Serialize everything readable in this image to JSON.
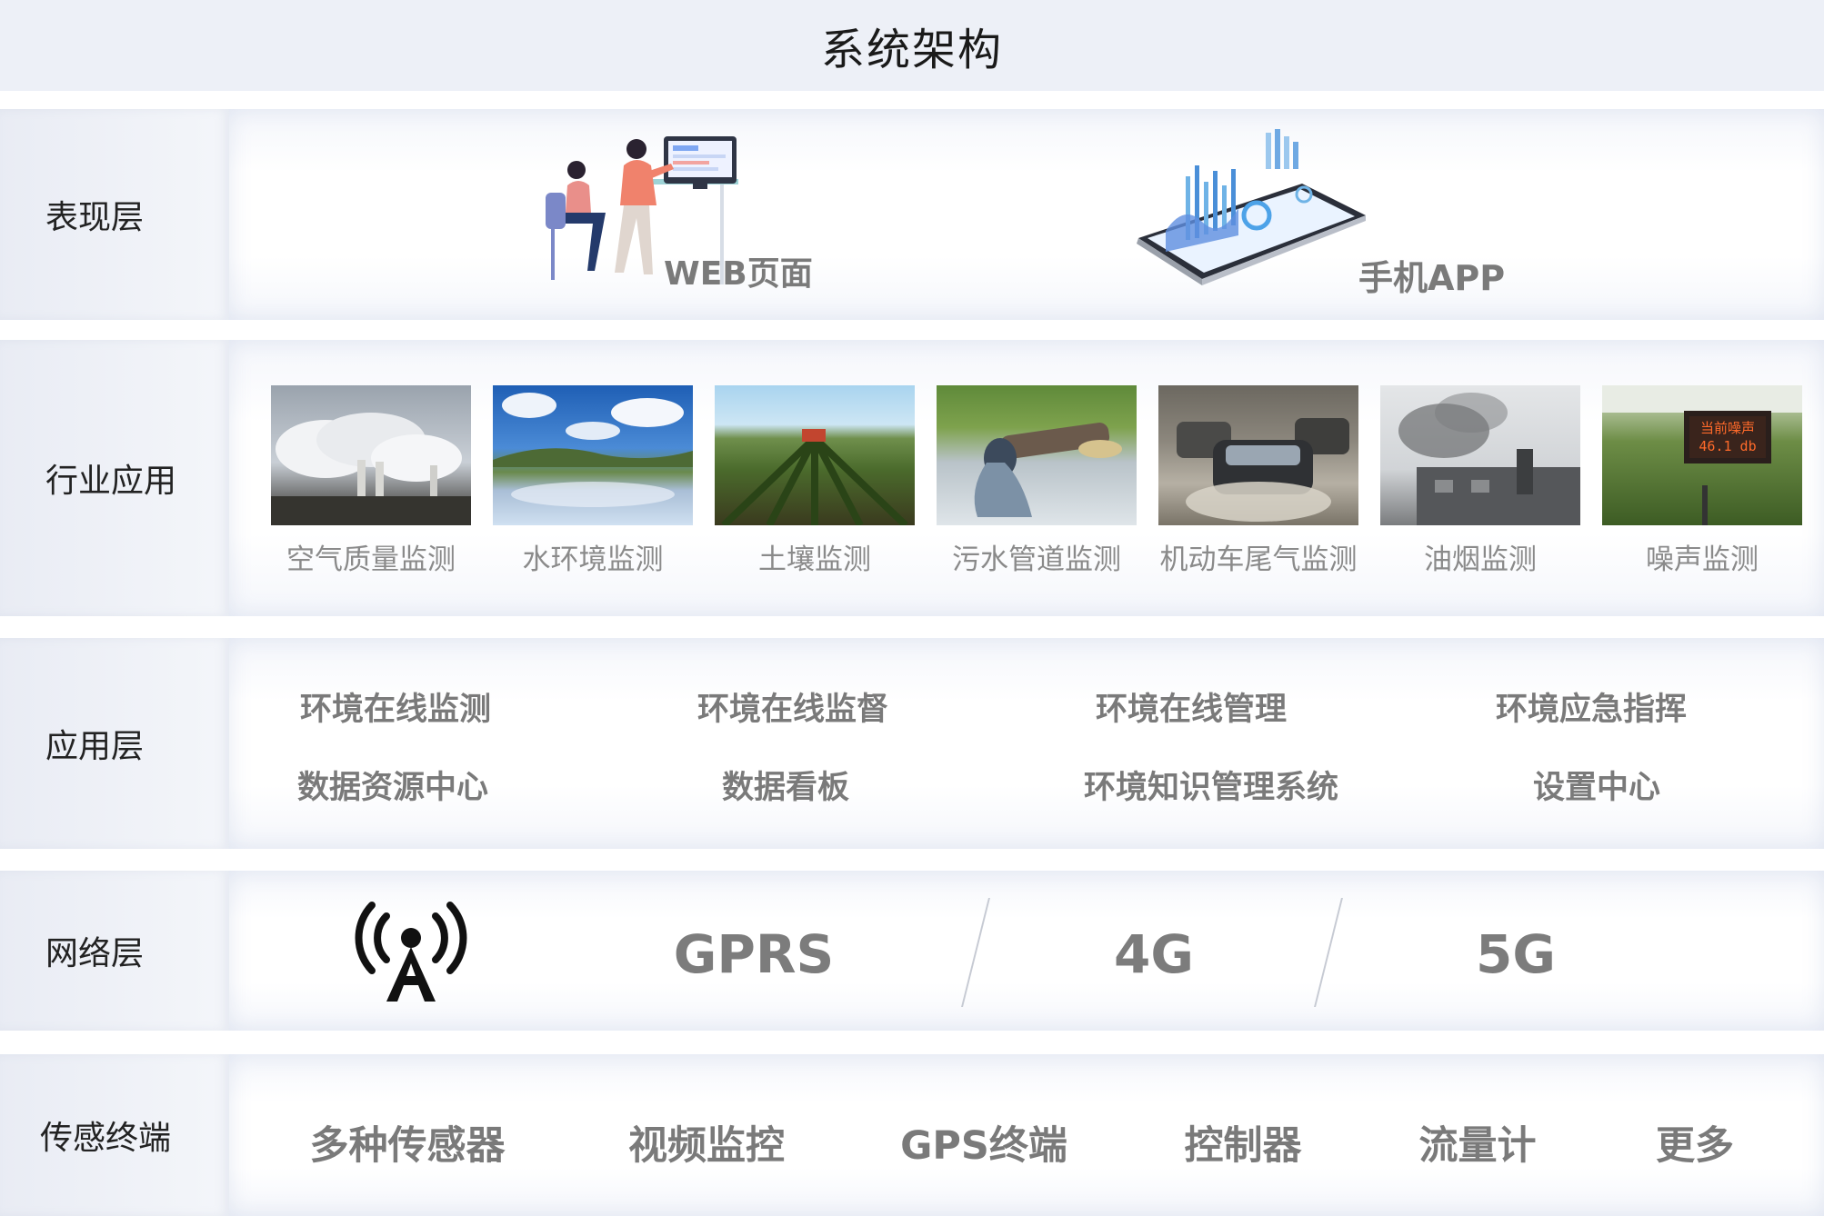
{
  "title": "系统架构",
  "layers": {
    "presentation": {
      "label": "表现层",
      "items": [
        "WEB页面",
        "手机APP"
      ]
    },
    "industry": {
      "label": "行业应用",
      "items": [
        "空气质量监测",
        "水环境监测",
        "土壤监测",
        "污水管道监测",
        "机动车尾气监测",
        "油烟监测",
        "噪声监测"
      ],
      "noise_sign": {
        "line1": "当前噪声",
        "line2": "46.1 db"
      }
    },
    "application": {
      "label": "应用层",
      "row1": [
        "环境在线监测",
        "环境在线监督",
        "环境在线管理",
        "环境应急指挥"
      ],
      "row2": [
        "数据资源中心",
        "数据看板",
        "环境知识管理系统",
        "设置中心"
      ]
    },
    "network": {
      "label": "网络层",
      "icon": "signal-tower-icon",
      "items": [
        "GPRS",
        "4G",
        "5G"
      ]
    },
    "sensor": {
      "label": "传感终端",
      "items": [
        "多种传感器",
        "视频监控",
        "GPS终端",
        "控制器",
        "流量计",
        "更多"
      ]
    }
  }
}
